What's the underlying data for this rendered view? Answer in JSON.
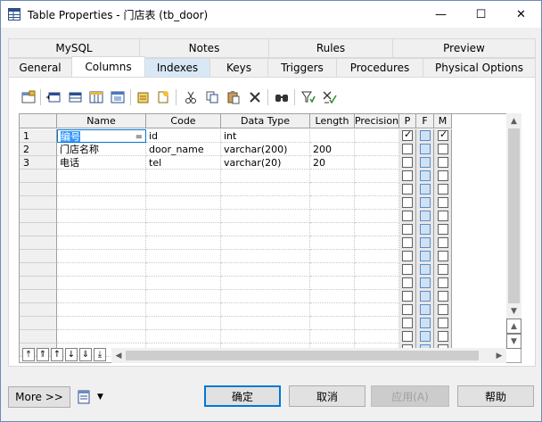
{
  "window": {
    "title": "Table Properties - 门店表 (tb_door)",
    "minimize": "—",
    "maximize": "☐",
    "close": "✕"
  },
  "tabs_row1": [
    "MySQL",
    "Notes",
    "Rules",
    "Preview"
  ],
  "tabs_row2": [
    "General",
    "Columns",
    "Indexes",
    "Keys",
    "Triggers",
    "Procedures",
    "Physical Options"
  ],
  "active_tab": "Columns",
  "toolbar_icons": [
    "properties-icon",
    "insert-row-icon",
    "add-row-icon",
    "add-columns-icon",
    "reuse-columns-icon",
    "new-domain-icon",
    "domain-icon",
    "cut-icon",
    "copy-icon",
    "paste-icon",
    "delete-icon",
    "find-icon",
    "filter-icon",
    "customize-columns-icon"
  ],
  "grid": {
    "headers": [
      "Name",
      "Code",
      "Data Type",
      "Length",
      "Precision",
      "P",
      "F",
      "M"
    ],
    "rows": [
      {
        "num": "1",
        "name": "编号",
        "code": "id",
        "datatype": "int",
        "length": "",
        "precision": "",
        "p": true,
        "f": false,
        "m": true
      },
      {
        "num": "2",
        "name": "门店名称",
        "code": "door_name",
        "datatype": "varchar(200)",
        "length": "200",
        "precision": "",
        "p": false,
        "f": false,
        "m": false
      },
      {
        "num": "3",
        "name": "电话",
        "code": "tel",
        "datatype": "varchar(20)",
        "length": "20",
        "precision": "",
        "p": false,
        "f": false,
        "m": false
      }
    ],
    "empty_rows": 14,
    "name_cell_button": "="
  },
  "nav_buttons": [
    "⤒",
    "⇑",
    "↑",
    "↓",
    "⇓",
    "⤓"
  ],
  "footer": {
    "more": "More >>",
    "ok": "确定",
    "cancel": "取消",
    "apply": "应用(A)",
    "help": "帮助"
  },
  "colors": {
    "accent": "#0078d7",
    "selected": "#d9e8f7"
  }
}
